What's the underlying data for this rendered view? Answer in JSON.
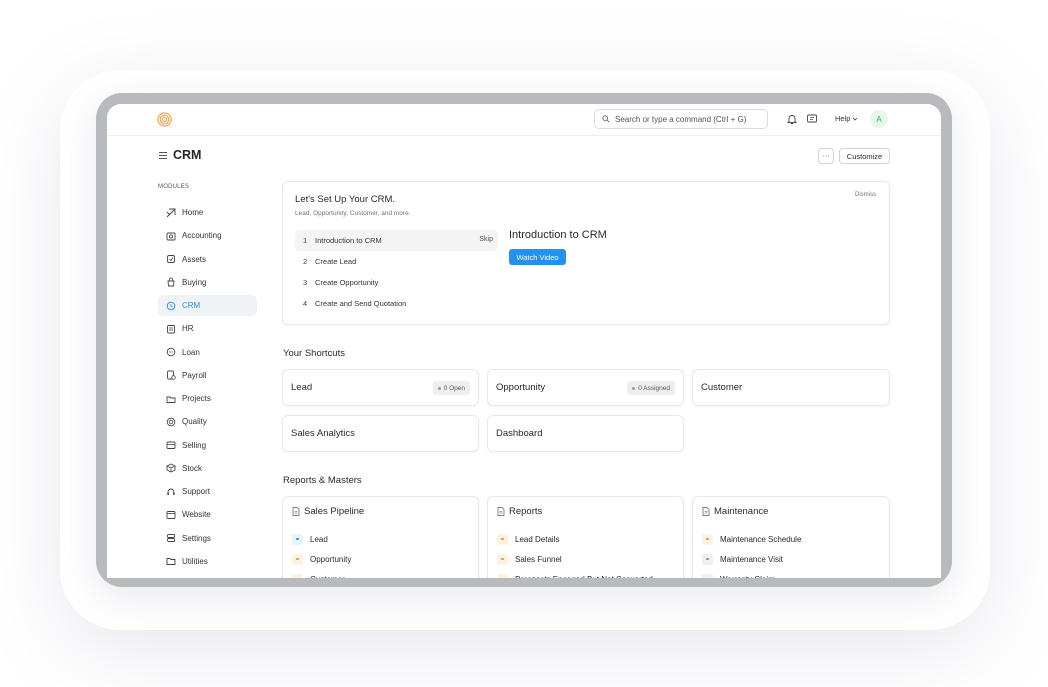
{
  "navbar": {
    "search_placeholder": "Search or type a command (Ctrl + G)",
    "help_label": "Help",
    "avatar_initial": "A"
  },
  "page": {
    "title": "CRM",
    "more_label": "···",
    "customize_label": "Customize"
  },
  "sidebar": {
    "section_label": "MODULES",
    "items": [
      {
        "label": "Home",
        "icon": "home-icon"
      },
      {
        "label": "Accounting",
        "icon": "accounting-icon"
      },
      {
        "label": "Assets",
        "icon": "assets-icon"
      },
      {
        "label": "Buying",
        "icon": "buying-icon"
      },
      {
        "label": "CRM",
        "icon": "crm-icon",
        "active": true
      },
      {
        "label": "HR",
        "icon": "hr-icon"
      },
      {
        "label": "Loan",
        "icon": "loan-icon"
      },
      {
        "label": "Payroll",
        "icon": "payroll-icon"
      },
      {
        "label": "Projects",
        "icon": "projects-icon"
      },
      {
        "label": "Quality",
        "icon": "quality-icon"
      },
      {
        "label": "Selling",
        "icon": "selling-icon"
      },
      {
        "label": "Stock",
        "icon": "stock-icon"
      },
      {
        "label": "Support",
        "icon": "support-icon"
      },
      {
        "label": "Website",
        "icon": "website-icon"
      },
      {
        "label": "Settings",
        "icon": "settings-icon"
      },
      {
        "label": "Utilities",
        "icon": "utilities-icon"
      }
    ]
  },
  "onboarding": {
    "title": "Let's Set Up Your CRM.",
    "subtitle": "Lead, Opportunity, Customer, and more.",
    "dismiss_label": "Dismiss",
    "steps": [
      {
        "num": "1",
        "label": "Introduction to CRM",
        "active": true,
        "skip": "Skip"
      },
      {
        "num": "2",
        "label": "Create Lead"
      },
      {
        "num": "3",
        "label": "Create Opportunity"
      },
      {
        "num": "4",
        "label": "Create and Send Quotation"
      }
    ],
    "detail_title": "Introduction to CRM",
    "watch_video_label": "Watch Video"
  },
  "shortcuts": {
    "title": "Your Shortcuts",
    "items": [
      {
        "label": "Lead",
        "badge": "0 Open"
      },
      {
        "label": "Opportunity",
        "badge": "0 Assigned"
      },
      {
        "label": "Customer",
        "badge": ""
      },
      {
        "label": "Sales Analytics",
        "badge": ""
      },
      {
        "label": "Dashboard",
        "badge": ""
      }
    ]
  },
  "reports": {
    "title": "Reports & Masters",
    "cards": [
      {
        "title": "Sales Pipeline",
        "items": [
          {
            "label": "Lead",
            "tone": "blue"
          },
          {
            "label": "Opportunity",
            "tone": "orange"
          },
          {
            "label": "Customer",
            "tone": "orange"
          }
        ]
      },
      {
        "title": "Reports",
        "items": [
          {
            "label": "Lead Details",
            "tone": "orange"
          },
          {
            "label": "Sales Funnel",
            "tone": "orange"
          },
          {
            "label": "Prospects Engaged But Not Converted",
            "tone": "orange"
          }
        ]
      },
      {
        "title": "Maintenance",
        "items": [
          {
            "label": "Maintenance Schedule",
            "tone": "orange"
          },
          {
            "label": "Maintenance Visit",
            "tone": "gray"
          },
          {
            "label": "Warranty Claim",
            "tone": "gray"
          }
        ]
      }
    ]
  },
  "colors": {
    "accent": "#2490ef",
    "logo": "#f1a22b",
    "tone_blue_bg": "#e8f2fd",
    "tone_blue_dot": "#2490ef",
    "tone_orange_bg": "#fef1e2",
    "tone_orange_dot": "#e7962d",
    "tone_gray_bg": "#eef0f2",
    "tone_gray_dot": "#8a8f96"
  }
}
